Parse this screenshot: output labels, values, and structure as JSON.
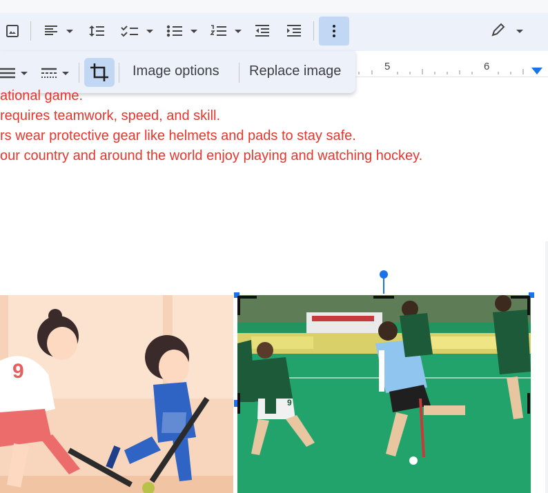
{
  "toolbar": {
    "items": [
      {
        "name": "insert-image-icon"
      },
      {
        "name": "align-icon"
      },
      {
        "name": "line-spacing-icon"
      },
      {
        "name": "checklist-icon"
      },
      {
        "name": "bulleted-list-icon"
      },
      {
        "name": "numbered-list-icon"
      },
      {
        "name": "decrease-indent-icon"
      },
      {
        "name": "increase-indent-icon"
      },
      {
        "name": "more-options-icon"
      },
      {
        "name": "editing-mode-pencil-icon"
      }
    ]
  },
  "ruler": {
    "marks": [
      "5",
      "6"
    ]
  },
  "image_toolbar": {
    "image_options_label": "Image options",
    "replace_image_label": "Replace image"
  },
  "document": {
    "lines": [
      "ational game.",
      " requires teamwork, speed, and skill.",
      "rs wear protective gear like helmets and pads to stay safe.",
      "our country and around the world enjoy playing and watching hockey."
    ],
    "text_color": "#e8352c"
  },
  "images": {
    "cartoon": {
      "description_name": "cartoon-hockey-players-image"
    },
    "photo": {
      "jersey_number": "9"
    }
  },
  "colors": {
    "toolbar_bg": "#edf2fa",
    "active_bg": "#c2d7f3",
    "accent": "#1a73e8"
  }
}
